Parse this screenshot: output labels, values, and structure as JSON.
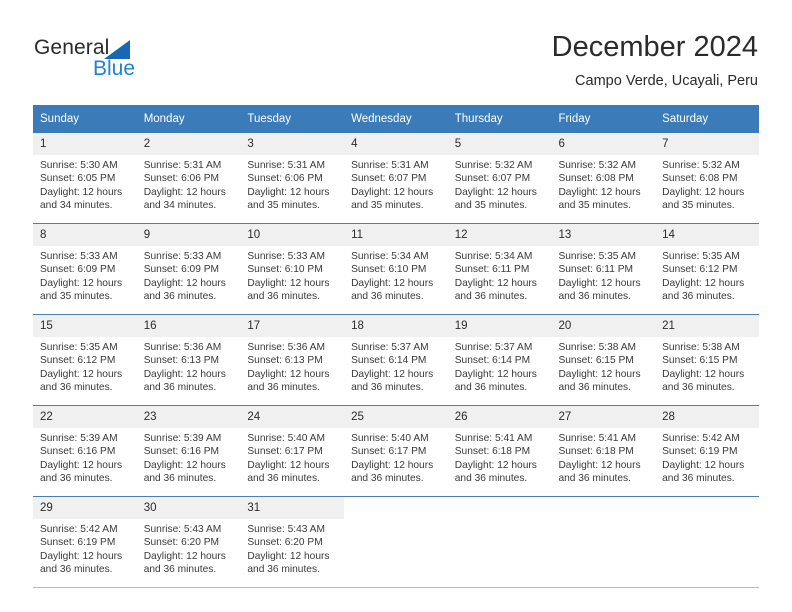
{
  "brand": {
    "name_part1": "General",
    "name_part2": "Blue",
    "triangle_color": "#1668b3",
    "blue_color": "#1f82d2"
  },
  "header": {
    "title": "December 2024",
    "subtitle": "Campo Verde, Ucayali, Peru"
  },
  "theme": {
    "header_row_bg": "#3b7cb8",
    "header_row_text": "#ffffff",
    "daynum_bg": "#f0f0f0",
    "row_divider": "#4a7fb5"
  },
  "weekday_headers": [
    "Sunday",
    "Monday",
    "Tuesday",
    "Wednesday",
    "Thursday",
    "Friday",
    "Saturday"
  ],
  "weeks": [
    [
      {
        "day": "1",
        "sunrise": "Sunrise: 5:30 AM",
        "sunset": "Sunset: 6:05 PM",
        "daylight1": "Daylight: 12 hours",
        "daylight2": "and 34 minutes."
      },
      {
        "day": "2",
        "sunrise": "Sunrise: 5:31 AM",
        "sunset": "Sunset: 6:06 PM",
        "daylight1": "Daylight: 12 hours",
        "daylight2": "and 34 minutes."
      },
      {
        "day": "3",
        "sunrise": "Sunrise: 5:31 AM",
        "sunset": "Sunset: 6:06 PM",
        "daylight1": "Daylight: 12 hours",
        "daylight2": "and 35 minutes."
      },
      {
        "day": "4",
        "sunrise": "Sunrise: 5:31 AM",
        "sunset": "Sunset: 6:07 PM",
        "daylight1": "Daylight: 12 hours",
        "daylight2": "and 35 minutes."
      },
      {
        "day": "5",
        "sunrise": "Sunrise: 5:32 AM",
        "sunset": "Sunset: 6:07 PM",
        "daylight1": "Daylight: 12 hours",
        "daylight2": "and 35 minutes."
      },
      {
        "day": "6",
        "sunrise": "Sunrise: 5:32 AM",
        "sunset": "Sunset: 6:08 PM",
        "daylight1": "Daylight: 12 hours",
        "daylight2": "and 35 minutes."
      },
      {
        "day": "7",
        "sunrise": "Sunrise: 5:32 AM",
        "sunset": "Sunset: 6:08 PM",
        "daylight1": "Daylight: 12 hours",
        "daylight2": "and 35 minutes."
      }
    ],
    [
      {
        "day": "8",
        "sunrise": "Sunrise: 5:33 AM",
        "sunset": "Sunset: 6:09 PM",
        "daylight1": "Daylight: 12 hours",
        "daylight2": "and 35 minutes."
      },
      {
        "day": "9",
        "sunrise": "Sunrise: 5:33 AM",
        "sunset": "Sunset: 6:09 PM",
        "daylight1": "Daylight: 12 hours",
        "daylight2": "and 36 minutes."
      },
      {
        "day": "10",
        "sunrise": "Sunrise: 5:33 AM",
        "sunset": "Sunset: 6:10 PM",
        "daylight1": "Daylight: 12 hours",
        "daylight2": "and 36 minutes."
      },
      {
        "day": "11",
        "sunrise": "Sunrise: 5:34 AM",
        "sunset": "Sunset: 6:10 PM",
        "daylight1": "Daylight: 12 hours",
        "daylight2": "and 36 minutes."
      },
      {
        "day": "12",
        "sunrise": "Sunrise: 5:34 AM",
        "sunset": "Sunset: 6:11 PM",
        "daylight1": "Daylight: 12 hours",
        "daylight2": "and 36 minutes."
      },
      {
        "day": "13",
        "sunrise": "Sunrise: 5:35 AM",
        "sunset": "Sunset: 6:11 PM",
        "daylight1": "Daylight: 12 hours",
        "daylight2": "and 36 minutes."
      },
      {
        "day": "14",
        "sunrise": "Sunrise: 5:35 AM",
        "sunset": "Sunset: 6:12 PM",
        "daylight1": "Daylight: 12 hours",
        "daylight2": "and 36 minutes."
      }
    ],
    [
      {
        "day": "15",
        "sunrise": "Sunrise: 5:35 AM",
        "sunset": "Sunset: 6:12 PM",
        "daylight1": "Daylight: 12 hours",
        "daylight2": "and 36 minutes."
      },
      {
        "day": "16",
        "sunrise": "Sunrise: 5:36 AM",
        "sunset": "Sunset: 6:13 PM",
        "daylight1": "Daylight: 12 hours",
        "daylight2": "and 36 minutes."
      },
      {
        "day": "17",
        "sunrise": "Sunrise: 5:36 AM",
        "sunset": "Sunset: 6:13 PM",
        "daylight1": "Daylight: 12 hours",
        "daylight2": "and 36 minutes."
      },
      {
        "day": "18",
        "sunrise": "Sunrise: 5:37 AM",
        "sunset": "Sunset: 6:14 PM",
        "daylight1": "Daylight: 12 hours",
        "daylight2": "and 36 minutes."
      },
      {
        "day": "19",
        "sunrise": "Sunrise: 5:37 AM",
        "sunset": "Sunset: 6:14 PM",
        "daylight1": "Daylight: 12 hours",
        "daylight2": "and 36 minutes."
      },
      {
        "day": "20",
        "sunrise": "Sunrise: 5:38 AM",
        "sunset": "Sunset: 6:15 PM",
        "daylight1": "Daylight: 12 hours",
        "daylight2": "and 36 minutes."
      },
      {
        "day": "21",
        "sunrise": "Sunrise: 5:38 AM",
        "sunset": "Sunset: 6:15 PM",
        "daylight1": "Daylight: 12 hours",
        "daylight2": "and 36 minutes."
      }
    ],
    [
      {
        "day": "22",
        "sunrise": "Sunrise: 5:39 AM",
        "sunset": "Sunset: 6:16 PM",
        "daylight1": "Daylight: 12 hours",
        "daylight2": "and 36 minutes."
      },
      {
        "day": "23",
        "sunrise": "Sunrise: 5:39 AM",
        "sunset": "Sunset: 6:16 PM",
        "daylight1": "Daylight: 12 hours",
        "daylight2": "and 36 minutes."
      },
      {
        "day": "24",
        "sunrise": "Sunrise: 5:40 AM",
        "sunset": "Sunset: 6:17 PM",
        "daylight1": "Daylight: 12 hours",
        "daylight2": "and 36 minutes."
      },
      {
        "day": "25",
        "sunrise": "Sunrise: 5:40 AM",
        "sunset": "Sunset: 6:17 PM",
        "daylight1": "Daylight: 12 hours",
        "daylight2": "and 36 minutes."
      },
      {
        "day": "26",
        "sunrise": "Sunrise: 5:41 AM",
        "sunset": "Sunset: 6:18 PM",
        "daylight1": "Daylight: 12 hours",
        "daylight2": "and 36 minutes."
      },
      {
        "day": "27",
        "sunrise": "Sunrise: 5:41 AM",
        "sunset": "Sunset: 6:18 PM",
        "daylight1": "Daylight: 12 hours",
        "daylight2": "and 36 minutes."
      },
      {
        "day": "28",
        "sunrise": "Sunrise: 5:42 AM",
        "sunset": "Sunset: 6:19 PM",
        "daylight1": "Daylight: 12 hours",
        "daylight2": "and 36 minutes."
      }
    ],
    [
      {
        "day": "29",
        "sunrise": "Sunrise: 5:42 AM",
        "sunset": "Sunset: 6:19 PM",
        "daylight1": "Daylight: 12 hours",
        "daylight2": "and 36 minutes."
      },
      {
        "day": "30",
        "sunrise": "Sunrise: 5:43 AM",
        "sunset": "Sunset: 6:20 PM",
        "daylight1": "Daylight: 12 hours",
        "daylight2": "and 36 minutes."
      },
      {
        "day": "31",
        "sunrise": "Sunrise: 5:43 AM",
        "sunset": "Sunset: 6:20 PM",
        "daylight1": "Daylight: 12 hours",
        "daylight2": "and 36 minutes."
      },
      {
        "day": "",
        "sunrise": "",
        "sunset": "",
        "daylight1": "",
        "daylight2": ""
      },
      {
        "day": "",
        "sunrise": "",
        "sunset": "",
        "daylight1": "",
        "daylight2": ""
      },
      {
        "day": "",
        "sunrise": "",
        "sunset": "",
        "daylight1": "",
        "daylight2": ""
      },
      {
        "day": "",
        "sunrise": "",
        "sunset": "",
        "daylight1": "",
        "daylight2": ""
      }
    ]
  ]
}
